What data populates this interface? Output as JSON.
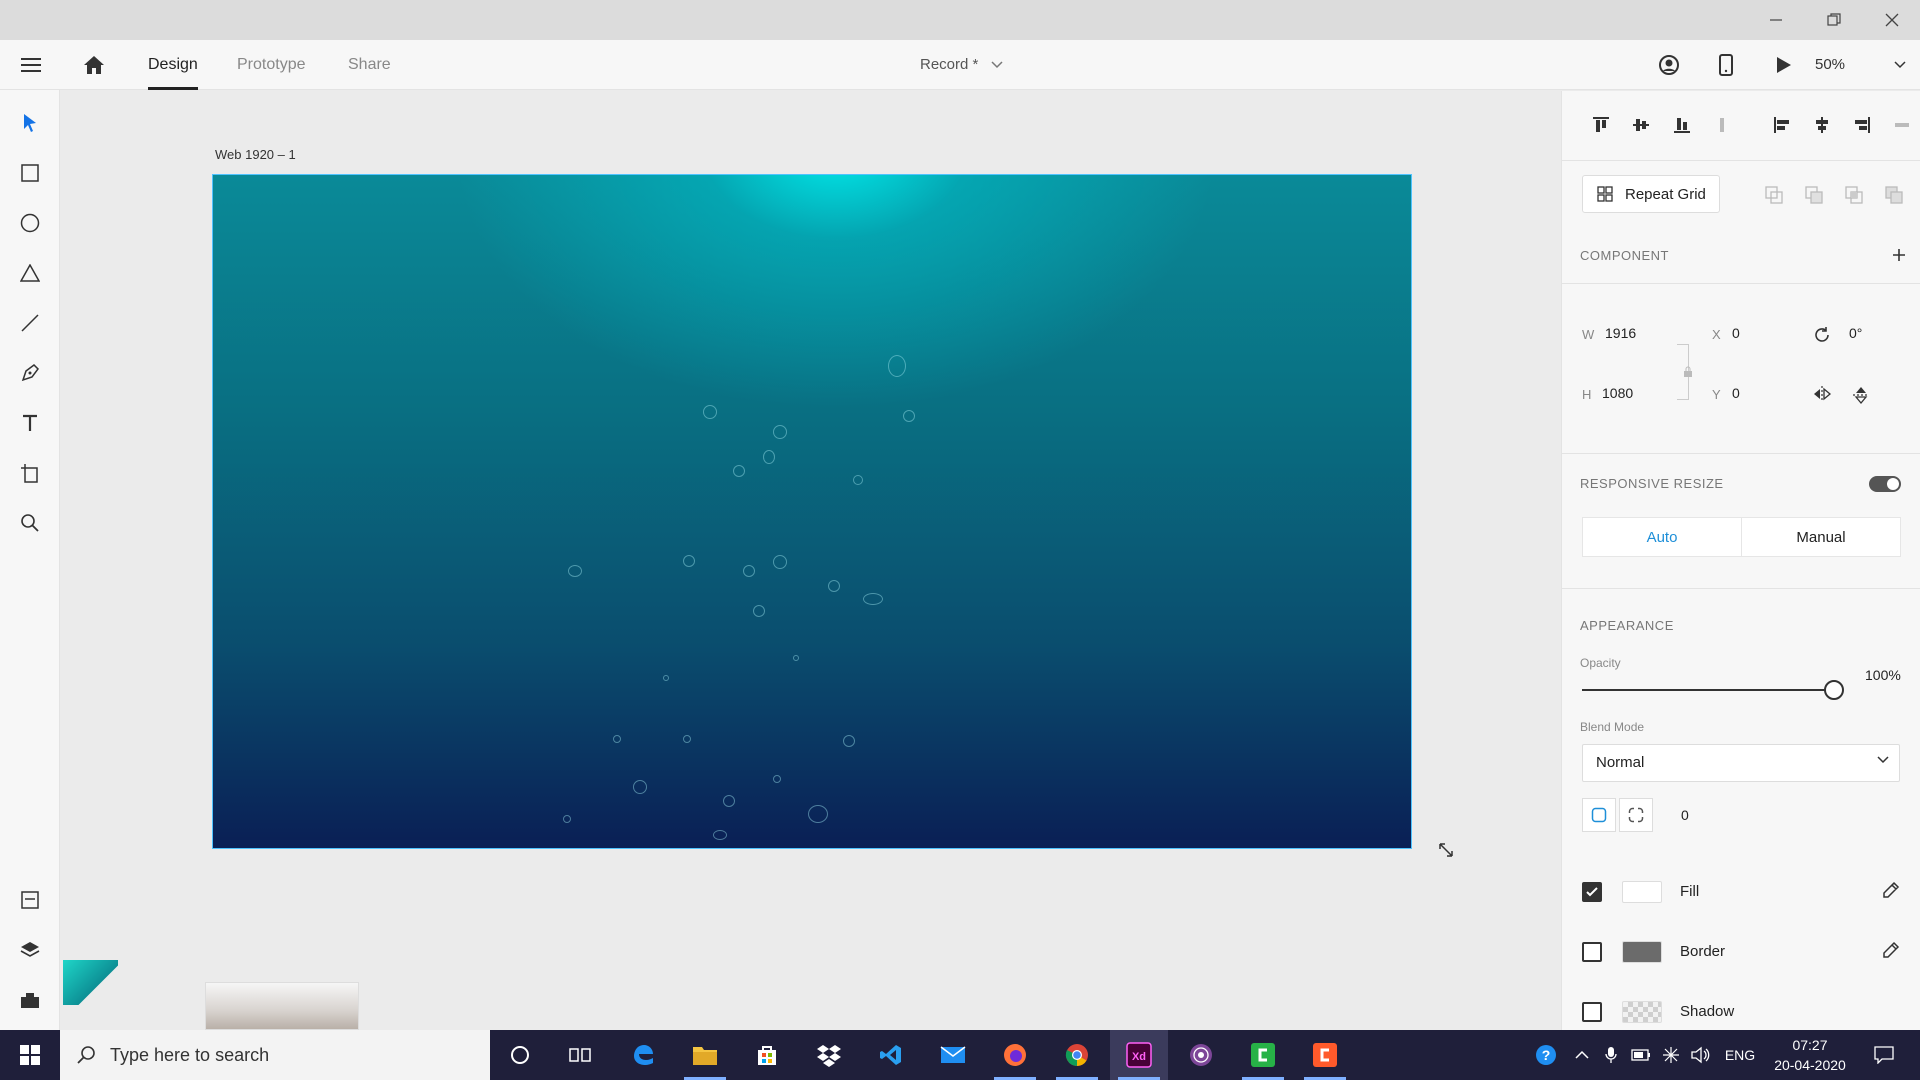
{
  "titlebar": {
    "controls": [
      "minimize",
      "restore",
      "close"
    ]
  },
  "toolbar": {
    "tabs": [
      {
        "label": "Design",
        "active": true
      },
      {
        "label": "Prototype",
        "active": false
      },
      {
        "label": "Share",
        "active": false
      }
    ],
    "document_name": "Record *",
    "zoom": "50%"
  },
  "tools": [
    "select-icon",
    "rectangle-icon",
    "ellipse-icon",
    "polygon-icon",
    "line-icon",
    "pen-icon",
    "text-icon",
    "artboard-icon",
    "zoom-icon"
  ],
  "left_bottom_tools": [
    "assets-icon",
    "layers-icon",
    "plugins-icon"
  ],
  "canvas": {
    "artboard_label": "Web 1920 – 1",
    "artboard_colors": {
      "top": "#00e6e6",
      "bottom": "#0a1f55"
    }
  },
  "panel": {
    "repeat_grid_label": "Repeat Grid",
    "component_heading": "COMPONENT",
    "transform": {
      "w_label": "W",
      "w_value": "1916",
      "h_label": "H",
      "h_value": "1080",
      "x_label": "X",
      "x_value": "0",
      "y_label": "Y",
      "y_value": "0",
      "rotation": "0°"
    },
    "responsive_resize": {
      "heading": "RESPONSIVE RESIZE",
      "enabled": true,
      "options": [
        {
          "label": "Auto",
          "selected": true
        },
        {
          "label": "Manual",
          "selected": false
        }
      ]
    },
    "appearance": {
      "heading": "APPEARANCE",
      "opacity_label": "Opacity",
      "opacity_value": "100%",
      "opacity_fraction": 1.0,
      "blend_label": "Blend Mode",
      "blend_value": "Normal",
      "corner_radius": "0"
    },
    "fill": {
      "label": "Fill",
      "checked": true,
      "color": "#ffffff"
    },
    "border": {
      "label": "Border",
      "checked": false,
      "color": "#6b6b6b"
    },
    "shadow": {
      "label": "Shadow",
      "checked": false
    }
  },
  "taskbar": {
    "search_placeholder": "Type here to search",
    "apps": [
      "cortana-icon",
      "task-view-icon",
      "edge-icon",
      "file-explorer-icon",
      "store-icon",
      "dropbox-icon",
      "vscode-icon",
      "mail-icon",
      "firefox-icon",
      "chrome-icon",
      "adobe-xd-icon",
      "tor-icon",
      "camtasia-icon",
      "camtasia-recorder-icon"
    ],
    "language": "ENG",
    "time": "07:27",
    "date": "20-04-2020"
  },
  "colors": {
    "accent_blue": "#1473e6",
    "taskbar": "#1f1f3a",
    "selected_tab_text": "#1e8fd8"
  }
}
